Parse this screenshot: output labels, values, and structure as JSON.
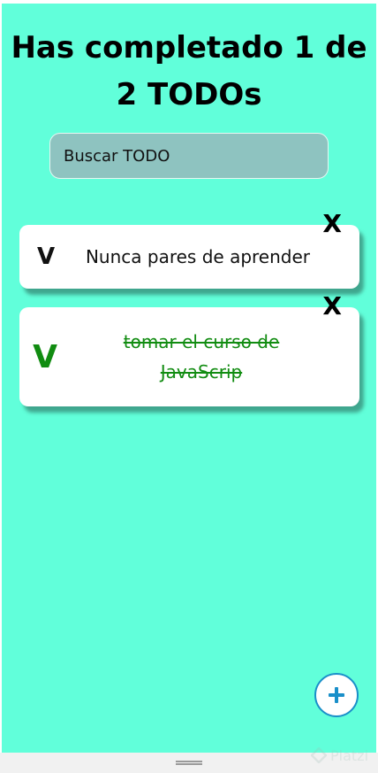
{
  "header": {
    "title_line1": "Has completado 1 de",
    "title_line2": "2 TODOs"
  },
  "search": {
    "placeholder": "Buscar TODO"
  },
  "todos": [
    {
      "check_label": "V",
      "text": "Nunca pares de aprender",
      "completed": false,
      "delete_label": "X"
    },
    {
      "check_label": "V",
      "text_line1": "tomar el curso de",
      "text_line2": "JavaScrip",
      "completed": true,
      "delete_label": "X"
    }
  ],
  "add_button": {
    "icon": "plus-icon"
  },
  "watermark": {
    "text": "Platzi"
  },
  "colors": {
    "background": "#61ffda",
    "completed": "#118c11",
    "accent": "#1a8fc9"
  }
}
